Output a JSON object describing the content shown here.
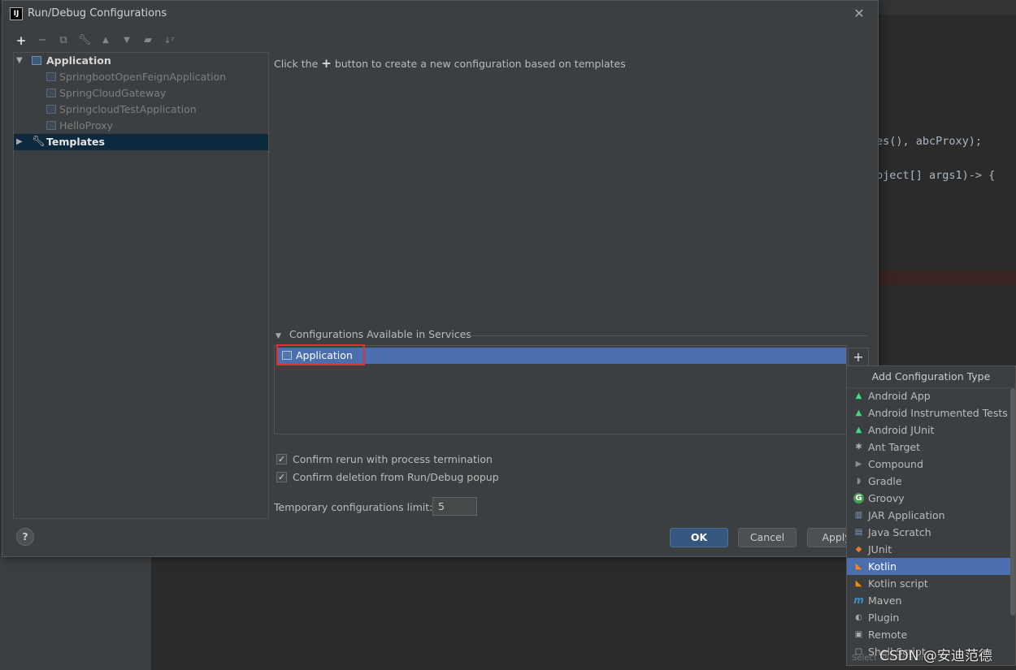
{
  "dialog": {
    "title": "Run/Debug Configurations",
    "app_icon": "IJ"
  },
  "toolbar": [
    "add-icon",
    "remove-icon",
    "copy-icon",
    "wrench-icon",
    "arrow-up-icon",
    "arrow-down-icon",
    "folder-icon",
    "sort-icon"
  ],
  "tree": {
    "application": {
      "label": "Application",
      "children": [
        "SpringbootOpenFeignApplication",
        "SpringCloudGateway",
        "SpringcloudTestApplication",
        "HelloProxy"
      ]
    },
    "templates": {
      "label": "Templates"
    }
  },
  "hint": {
    "before": "Click the",
    "after": "button to create a new configuration based on templates"
  },
  "services": {
    "header": "Configurations Available in Services",
    "item": "Application"
  },
  "options": {
    "confirm_rerun": "Confirm rerun with process termination",
    "confirm_deletion": "Confirm deletion from Run/Debug popup",
    "temp_limit_label": "Temporary configurations limit:",
    "temp_limit_value": "5"
  },
  "buttons": {
    "ok": "OK",
    "cancel": "Cancel",
    "apply": "Apply",
    "help": "?"
  },
  "popup": {
    "header": "Add Configuration Type",
    "items": [
      "Android App",
      "Android Instrumented Tests",
      "Android JUnit",
      "Ant Target",
      "Compound",
      "Gradle",
      "Groovy",
      "JAR Application",
      "Java Scratch",
      "JUnit",
      "Kotlin",
      "Kotlin script",
      "Maven",
      "Plugin",
      "Remote",
      "Shell Script"
    ],
    "selected": "Kotlin",
    "footer": "Select one or more ..."
  },
  "background_code": [
    "es(), abcProxy);",
    "bject[] args1)-> {"
  ],
  "watermark": "CSDN @安迪范德"
}
